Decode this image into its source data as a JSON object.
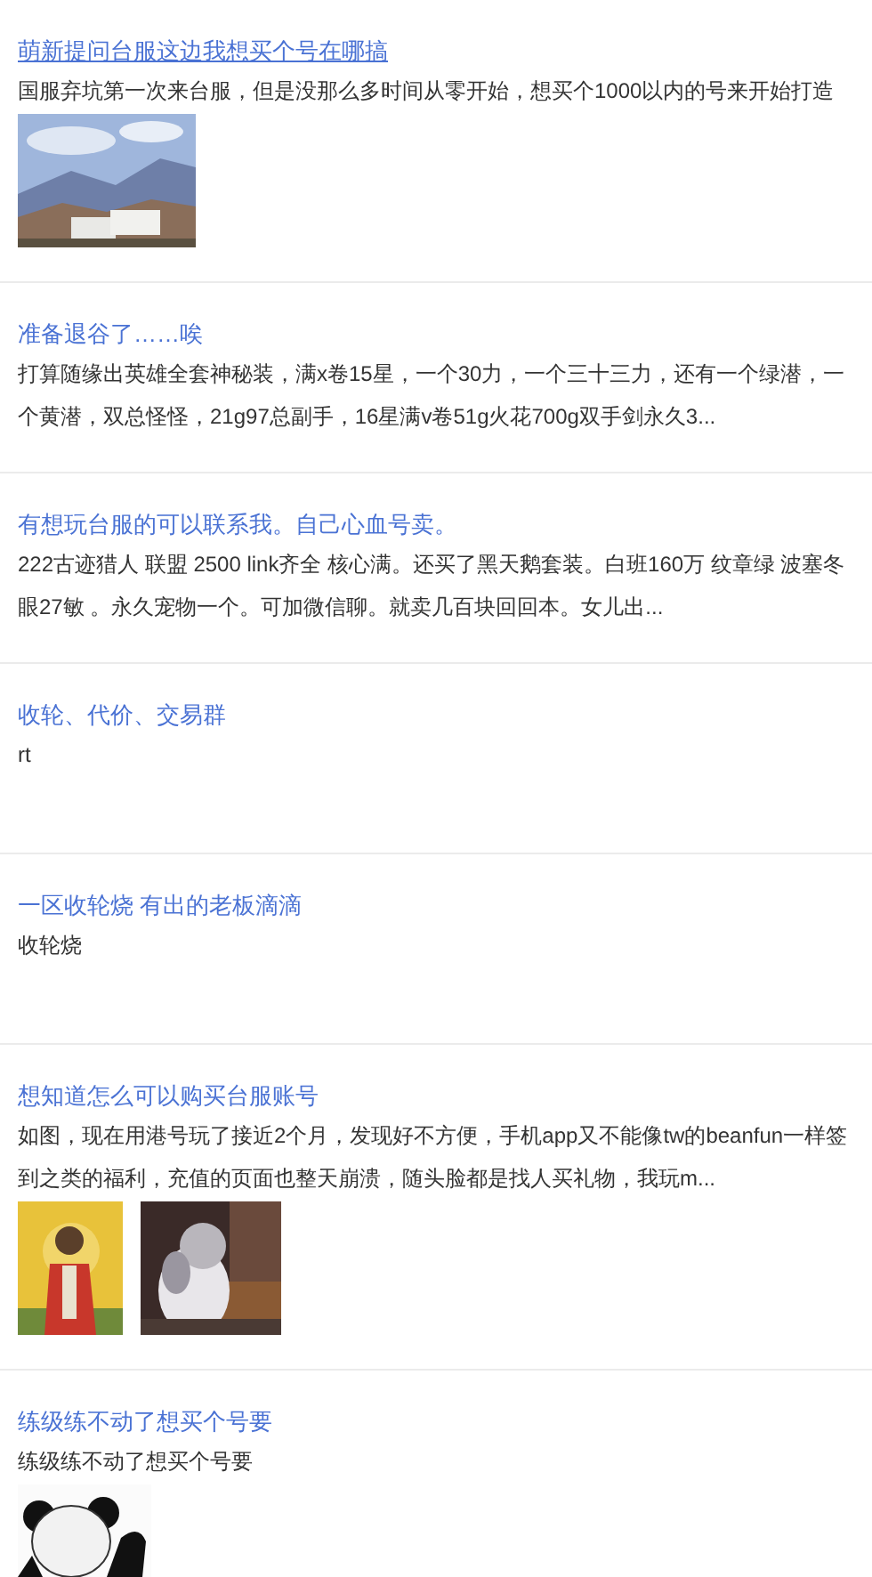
{
  "posts": [
    {
      "title": "萌新提问台服这边我想买个号在哪搞",
      "underlined": true,
      "body": "国服弃坑第一次来台服，但是没那么多时间从零开始，想买个1000以内的号来开始打造"
    },
    {
      "title": "准备退谷了……唉",
      "underlined": false,
      "body": "打算随缘出英雄全套神秘装，满x卷15星，一个30力，一个三十三力，还有一个绿潜，一个黄潜，双总怪怪，21g97总副手，16星满v卷51g火花700g双手剑永久3..."
    },
    {
      "title": "有想玩台服的可以联系我。自己心血号卖。",
      "underlined": false,
      "body": "222古迹猎人 联盟 2500 link齐全 核心满。还买了黑天鹅套装。白班160万 纹章绿 波塞冬眼27敏 。永久宠物一个。可加微信聊。就卖几百块回回本。女儿出..."
    },
    {
      "title": "收轮、代价、交易群",
      "underlined": false,
      "body": "rt"
    },
    {
      "title": "一区收轮烧 有出的老板滴滴",
      "underlined": false,
      "body": "收轮烧"
    },
    {
      "title": "想知道怎么可以购买台服账号",
      "underlined": false,
      "body": "如图，现在用港号玩了接近2个月，发现好不方便，手机app又不能像tw的beanfun一样签到之类的福利，充值的页面也整天崩溃，随头脸都是找人买礼物，我玩m..."
    },
    {
      "title": "练级练不动了想买个号要",
      "underlined": false,
      "body": "练级练不动了想买个号要"
    }
  ]
}
